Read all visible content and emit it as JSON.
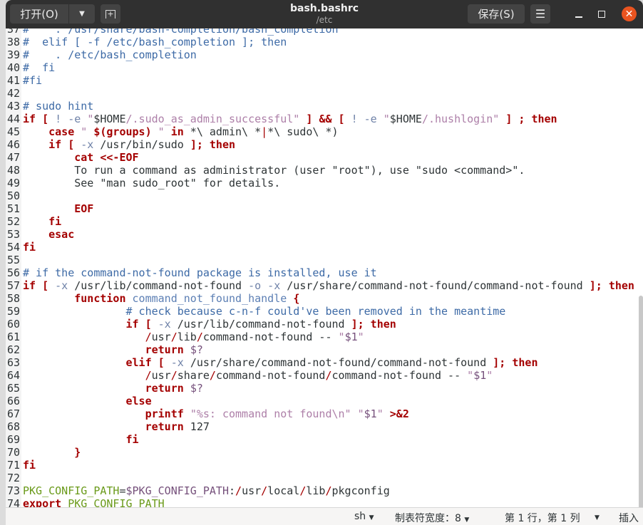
{
  "header": {
    "open_label": "打开(O)",
    "save_label": "保存(S)",
    "title": "bash.bashrc",
    "subtitle": "/etc"
  },
  "status": {
    "language": "sh",
    "tab_width": "制表符宽度：8",
    "position": "第 1 行，第 1 列",
    "mode": "插入"
  },
  "colors": {
    "accent_close": "#e95420",
    "keyword": "#a40000",
    "comment": "#3d6aa6"
  },
  "lines": [
    {
      "n": "37",
      "t": [
        [
          "c",
          "#    . /usr/share/bash-completion/bash_completion"
        ]
      ]
    },
    {
      "n": "38",
      "t": [
        [
          "c",
          "#  elif [ -f /etc/bash_completion ]; then"
        ]
      ]
    },
    {
      "n": "39",
      "t": [
        [
          "c",
          "#    . /etc/bash_completion"
        ]
      ]
    },
    {
      "n": "40",
      "t": [
        [
          "c",
          "#  fi"
        ]
      ]
    },
    {
      "n": "41",
      "t": [
        [
          "c",
          "#fi"
        ]
      ]
    },
    {
      "n": "42",
      "t": []
    },
    {
      "n": "43",
      "t": [
        [
          "c",
          "# sudo hint"
        ]
      ]
    },
    {
      "n": "44",
      "t": [
        [
          "k",
          "if"
        ],
        [
          "p",
          " "
        ],
        [
          "k",
          "["
        ],
        [
          "o",
          " ! -e "
        ],
        [
          "s",
          "\""
        ],
        [
          "p",
          "$HOME"
        ],
        [
          "s",
          "/.sudo_as_admin_successful\""
        ],
        [
          "p",
          " "
        ],
        [
          "k",
          "]"
        ],
        [
          "p",
          " "
        ],
        [
          "k",
          "&&"
        ],
        [
          "p",
          " "
        ],
        [
          "k",
          "["
        ],
        [
          "o",
          " ! -e "
        ],
        [
          "s",
          "\""
        ],
        [
          "p",
          "$HOME"
        ],
        [
          "s",
          "/.hushlogin\""
        ],
        [
          "p",
          " "
        ],
        [
          "k",
          "]"
        ],
        [
          "p",
          " "
        ],
        [
          "k",
          "; then"
        ]
      ]
    },
    {
      "n": "45",
      "t": [
        [
          "p",
          "    "
        ],
        [
          "k",
          "case"
        ],
        [
          "s",
          " \" "
        ],
        [
          "k",
          "$(groups)"
        ],
        [
          "s",
          " \" "
        ],
        [
          "k",
          "in"
        ],
        [
          "p",
          " *\\ admin\\ *"
        ],
        [
          "r",
          "|"
        ],
        [
          "p",
          "*\\ sudo\\ *)"
        ]
      ]
    },
    {
      "n": "46",
      "t": [
        [
          "p",
          "    "
        ],
        [
          "k",
          "if"
        ],
        [
          "p",
          " "
        ],
        [
          "k",
          "["
        ],
        [
          "o",
          " -x "
        ],
        [
          "p",
          "/usr/bin/sudo "
        ],
        [
          "k",
          "]; then"
        ]
      ]
    },
    {
      "n": "47",
      "t": [
        [
          "p",
          "        "
        ],
        [
          "k",
          "cat <<-EOF"
        ]
      ]
    },
    {
      "n": "48",
      "t": [
        [
          "p",
          "        To run a command as administrator (user \"root\"), use \"sudo <command>\"."
        ]
      ]
    },
    {
      "n": "49",
      "t": [
        [
          "p",
          "        See \"man sudo_root\" for details."
        ]
      ]
    },
    {
      "n": "50",
      "t": []
    },
    {
      "n": "51",
      "t": [
        [
          "p",
          "        "
        ],
        [
          "k",
          "EOF"
        ]
      ]
    },
    {
      "n": "52",
      "t": [
        [
          "p",
          "    "
        ],
        [
          "k",
          "fi"
        ]
      ]
    },
    {
      "n": "53",
      "t": [
        [
          "p",
          "    "
        ],
        [
          "k",
          "esac"
        ]
      ]
    },
    {
      "n": "54",
      "t": [
        [
          "k",
          "fi"
        ]
      ]
    },
    {
      "n": "55",
      "t": []
    },
    {
      "n": "56",
      "t": [
        [
          "c",
          "# if the command-not-found package is installed, use it"
        ]
      ]
    },
    {
      "n": "57",
      "t": [
        [
          "k",
          "if"
        ],
        [
          "p",
          " "
        ],
        [
          "k",
          "["
        ],
        [
          "o",
          " -x "
        ],
        [
          "p",
          "/usr/lib/command-not-found"
        ],
        [
          "o",
          " -o -x "
        ],
        [
          "p",
          "/usr/share/command-not-found/command-not-found "
        ],
        [
          "k",
          "]; then"
        ]
      ]
    },
    {
      "n": "58",
      "t": [
        [
          "p",
          "        "
        ],
        [
          "k",
          "function"
        ],
        [
          "p",
          " "
        ],
        [
          "f",
          "command_not_found_handle"
        ],
        [
          "p",
          " "
        ],
        [
          "k",
          "{"
        ]
      ]
    },
    {
      "n": "59",
      "t": [
        [
          "p",
          "                "
        ],
        [
          "c",
          "# check because c-n-f could've been removed in the meantime"
        ]
      ]
    },
    {
      "n": "60",
      "t": [
        [
          "p",
          "                "
        ],
        [
          "k",
          "if"
        ],
        [
          "p",
          " "
        ],
        [
          "k",
          "["
        ],
        [
          "o",
          " -x "
        ],
        [
          "p",
          "/usr/lib/command-not-found "
        ],
        [
          "k",
          "]; then"
        ]
      ]
    },
    {
      "n": "61",
      "t": [
        [
          "p",
          "                   "
        ],
        [
          "r",
          "/"
        ],
        [
          "p",
          "usr"
        ],
        [
          "r",
          "/"
        ],
        [
          "p",
          "lib"
        ],
        [
          "r",
          "/"
        ],
        [
          "p",
          "command-not-found -- "
        ],
        [
          "s",
          "\""
        ],
        [
          "vp",
          "$1"
        ],
        [
          "s",
          "\""
        ]
      ]
    },
    {
      "n": "62",
      "t": [
        [
          "p",
          "                   "
        ],
        [
          "k",
          "return"
        ],
        [
          "p",
          " "
        ],
        [
          "vp",
          "$?"
        ]
      ]
    },
    {
      "n": "63",
      "t": [
        [
          "p",
          "                "
        ],
        [
          "k",
          "elif"
        ],
        [
          "p",
          " "
        ],
        [
          "k",
          "["
        ],
        [
          "o",
          " -x "
        ],
        [
          "p",
          "/usr/share/command-not-found/command-not-found "
        ],
        [
          "k",
          "]; then"
        ]
      ]
    },
    {
      "n": "64",
      "t": [
        [
          "p",
          "                   "
        ],
        [
          "r",
          "/"
        ],
        [
          "p",
          "usr"
        ],
        [
          "r",
          "/"
        ],
        [
          "p",
          "share"
        ],
        [
          "r",
          "/"
        ],
        [
          "p",
          "command-not-found"
        ],
        [
          "r",
          "/"
        ],
        [
          "p",
          "command-not-found -- "
        ],
        [
          "s",
          "\""
        ],
        [
          "vp",
          "$1"
        ],
        [
          "s",
          "\""
        ]
      ]
    },
    {
      "n": "65",
      "t": [
        [
          "p",
          "                   "
        ],
        [
          "k",
          "return"
        ],
        [
          "p",
          " "
        ],
        [
          "vp",
          "$?"
        ]
      ]
    },
    {
      "n": "66",
      "t": [
        [
          "p",
          "                "
        ],
        [
          "k",
          "else"
        ]
      ]
    },
    {
      "n": "67",
      "t": [
        [
          "p",
          "                   "
        ],
        [
          "k",
          "printf"
        ],
        [
          "p",
          " "
        ],
        [
          "s",
          "\"%s: command not found\\n\""
        ],
        [
          "p",
          " "
        ],
        [
          "s",
          "\""
        ],
        [
          "vp",
          "$1"
        ],
        [
          "s",
          "\""
        ],
        [
          "p",
          " "
        ],
        [
          "k",
          ">&2"
        ]
      ]
    },
    {
      "n": "68",
      "t": [
        [
          "p",
          "                   "
        ],
        [
          "k",
          "return"
        ],
        [
          "p",
          " 127"
        ]
      ]
    },
    {
      "n": "69",
      "t": [
        [
          "p",
          "                "
        ],
        [
          "k",
          "fi"
        ]
      ]
    },
    {
      "n": "70",
      "t": [
        [
          "p",
          "        "
        ],
        [
          "k",
          "}"
        ]
      ]
    },
    {
      "n": "71",
      "t": [
        [
          "k",
          "fi"
        ]
      ]
    },
    {
      "n": "72",
      "t": []
    },
    {
      "n": "73",
      "t": [
        [
          "g",
          "PKG_CONFIG_PATH"
        ],
        [
          "p",
          "="
        ],
        [
          "vp",
          "$PKG_CONFIG_PATH"
        ],
        [
          "p",
          ":"
        ],
        [
          "r",
          "/"
        ],
        [
          "p",
          "usr"
        ],
        [
          "r",
          "/"
        ],
        [
          "p",
          "local"
        ],
        [
          "r",
          "/"
        ],
        [
          "p",
          "lib"
        ],
        [
          "r",
          "/"
        ],
        [
          "p",
          "pkgconfig"
        ]
      ]
    },
    {
      "n": "74",
      "t": [
        [
          "k",
          "export"
        ],
        [
          "p",
          " "
        ],
        [
          "g",
          "PKG_CONFIG_PATH"
        ]
      ]
    }
  ]
}
